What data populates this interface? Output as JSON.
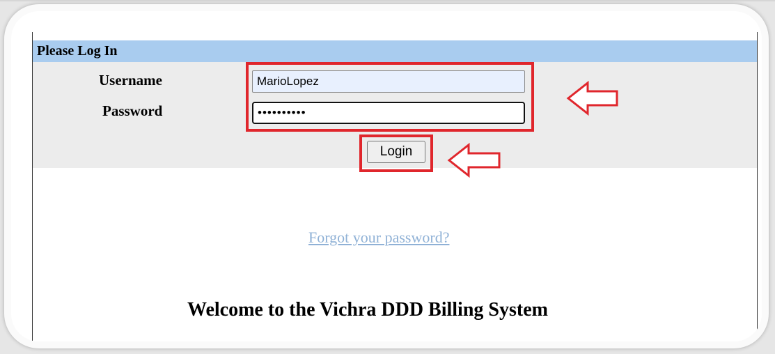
{
  "header": {
    "title": "Please Log In"
  },
  "form": {
    "username_label": "Username",
    "password_label": "Password",
    "username_value": "MarioLopez",
    "password_value": "••••••••••",
    "login_label": "Login"
  },
  "links": {
    "forgot_password": "Forgot your password?"
  },
  "welcome_text": "Welcome to the Vichra DDD Billing System",
  "colors": {
    "header_bg": "#a9ccef",
    "annotation": "#e0262c",
    "link": "#8fb1d6"
  },
  "annotations": {
    "arrow_icon": "left-arrow-outline-icon"
  }
}
